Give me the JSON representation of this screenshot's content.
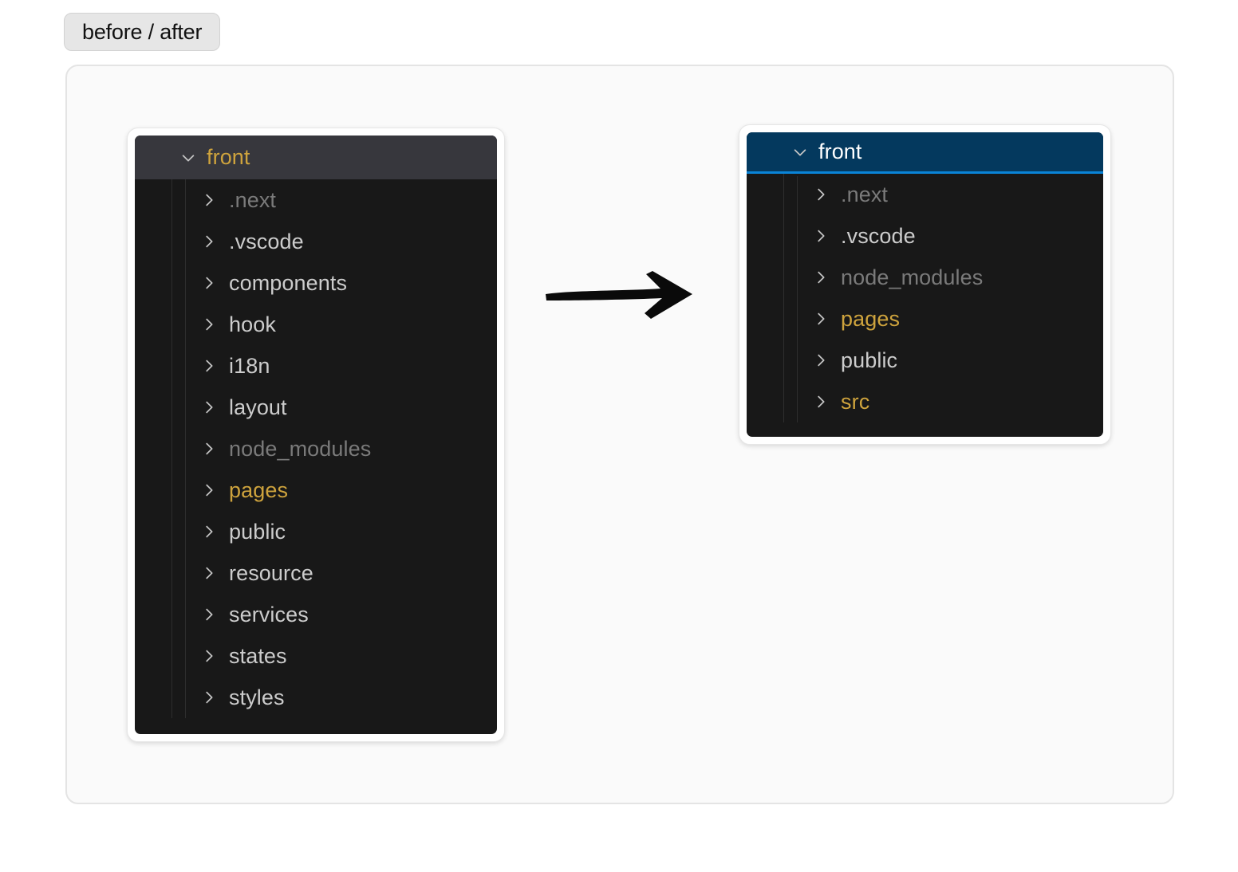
{
  "caption": {
    "label": "before / after"
  },
  "colors": {
    "page_bg": "#FFFFFF",
    "frame_bg": "#FAFAFA",
    "frame_border": "#E4E4E4",
    "badge_bg": "#E6E6E6",
    "editor_bg": "#181818",
    "row_inactive_selection_bg": "#37373D",
    "row_selected_bg": "#04395E",
    "row_selected_border": "#0A84D8",
    "text_default": "#CCCCCC",
    "text_ignored": "#7A7A7A",
    "text_modified": "#CEA33D",
    "text_selected": "#FFFFFF",
    "indent_guide": "#2E2E2E",
    "arrow": "#000000"
  },
  "before_panel": {
    "name": "before",
    "root": {
      "label": "front",
      "expanded": true,
      "chevron": "chevron-down-icon",
      "color": "gold",
      "row_state": "inactive-selected"
    },
    "items": [
      {
        "label": ".next",
        "chevron": "chevron-right-icon",
        "color": "muted"
      },
      {
        "label": ".vscode",
        "chevron": "chevron-right-icon",
        "color": "default"
      },
      {
        "label": "components",
        "chevron": "chevron-right-icon",
        "color": "default"
      },
      {
        "label": "hook",
        "chevron": "chevron-right-icon",
        "color": "default"
      },
      {
        "label": "i18n",
        "chevron": "chevron-right-icon",
        "color": "default"
      },
      {
        "label": "layout",
        "chevron": "chevron-right-icon",
        "color": "default"
      },
      {
        "label": "node_modules",
        "chevron": "chevron-right-icon",
        "color": "muted"
      },
      {
        "label": "pages",
        "chevron": "chevron-right-icon",
        "color": "gold"
      },
      {
        "label": "public",
        "chevron": "chevron-right-icon",
        "color": "default"
      },
      {
        "label": "resource",
        "chevron": "chevron-right-icon",
        "color": "default"
      },
      {
        "label": "services",
        "chevron": "chevron-right-icon",
        "color": "default"
      },
      {
        "label": "states",
        "chevron": "chevron-right-icon",
        "color": "default"
      },
      {
        "label": "styles",
        "chevron": "chevron-right-icon",
        "color": "default"
      }
    ]
  },
  "after_panel": {
    "name": "after",
    "root": {
      "label": "front",
      "expanded": true,
      "chevron": "chevron-down-icon",
      "color": "white",
      "row_state": "selected"
    },
    "items": [
      {
        "label": ".next",
        "chevron": "chevron-right-icon",
        "color": "muted"
      },
      {
        "label": ".vscode",
        "chevron": "chevron-right-icon",
        "color": "default"
      },
      {
        "label": "node_modules",
        "chevron": "chevron-right-icon",
        "color": "muted"
      },
      {
        "label": "pages",
        "chevron": "chevron-right-icon",
        "color": "gold"
      },
      {
        "label": "public",
        "chevron": "chevron-right-icon",
        "color": "default"
      },
      {
        "label": "src",
        "chevron": "chevron-right-icon",
        "color": "gold"
      }
    ]
  },
  "transition": {
    "icon": "arrow-right-icon"
  }
}
